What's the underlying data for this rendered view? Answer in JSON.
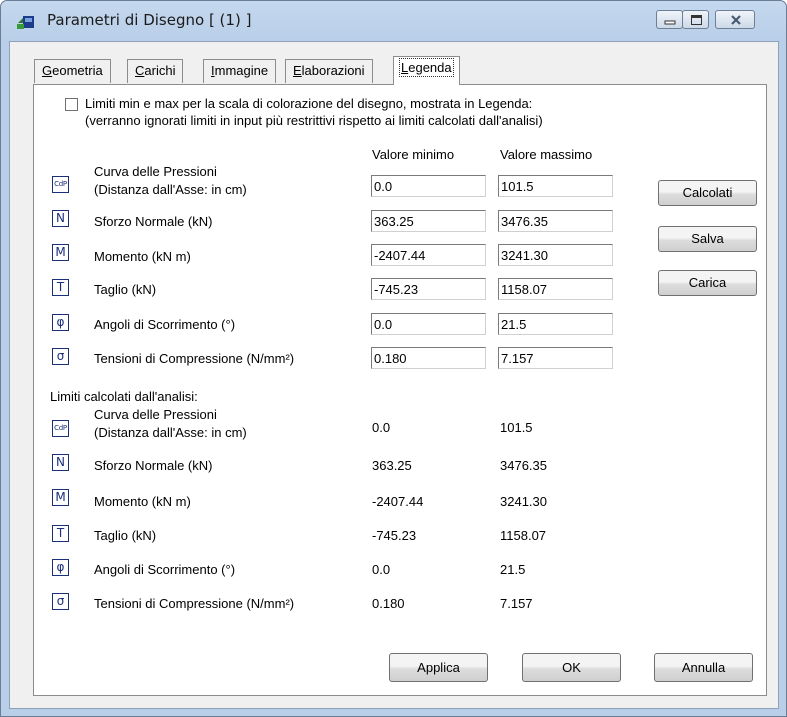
{
  "window": {
    "title": "Parametri di Disegno [ (1) ]"
  },
  "tabs": [
    {
      "pre": "",
      "u": "G",
      "post": "eometria"
    },
    {
      "pre": "",
      "u": "C",
      "post": "arichi"
    },
    {
      "pre": "",
      "u": "I",
      "post": "mmagine"
    },
    {
      "pre": "",
      "u": "E",
      "post": "laborazioni"
    },
    {
      "pre": "",
      "u": "L",
      "post": "egenda"
    }
  ],
  "limits_checkbox": {
    "checked": false,
    "label_line1": "Limiti min e max per la scala di colorazione del disegno, mostrata in Legenda:",
    "label_line2": "(verranno ignorati limiti in input più restrittivi rispetto ai limiti calcolati dall'analisi)"
  },
  "columns": {
    "min": "Valore minimo",
    "max": "Valore massimo"
  },
  "rows": [
    {
      "icon": "CdP",
      "label1": "Curva delle Pressioni",
      "label2": "(Distanza dall'Asse: in cm)",
      "min": "0.0",
      "max": "101.5"
    },
    {
      "icon": "N",
      "label1": "Sforzo Normale (kN)",
      "min": "363.25",
      "max": "3476.35"
    },
    {
      "icon": "M",
      "label1": "Momento (kN m)",
      "min": "-2407.44",
      "max": "3241.30"
    },
    {
      "icon": "T",
      "label1": "Taglio (kN)",
      "min": "-745.23",
      "max": "1158.07"
    },
    {
      "icon": "φ",
      "label1": "Angoli di Scorrimento (°)",
      "min": "0.0",
      "max": "21.5"
    },
    {
      "icon": "σ",
      "label1": "Tensioni di Compressione (N/mm²)",
      "min": "0.180",
      "max": "7.157"
    }
  ],
  "computed_heading": "Limiti calcolati dall'analisi:",
  "computed": [
    {
      "icon": "CdP",
      "label1": "Curva delle Pressioni",
      "label2": "(Distanza dall'Asse: in cm)",
      "min": "0.0",
      "max": "101.5"
    },
    {
      "icon": "N",
      "label1": "Sforzo Normale (kN)",
      "min": "363.25",
      "max": "3476.35"
    },
    {
      "icon": "M",
      "label1": "Momento (kN m)",
      "min": "-2407.44",
      "max": "3241.30"
    },
    {
      "icon": "T",
      "label1": "Taglio (kN)",
      "min": "-745.23",
      "max": "1158.07"
    },
    {
      "icon": "φ",
      "label1": "Angoli di Scorrimento (°)",
      "min": "0.0",
      "max": "21.5"
    },
    {
      "icon": "σ",
      "label1": "Tensioni di Compressione (N/mm²)",
      "min": "0.180",
      "max": "7.157"
    }
  ],
  "side_buttons": {
    "calcolati": "Calcolati",
    "salva": "Salva",
    "carica": "Carica"
  },
  "bottom_buttons": {
    "applica": "Applica",
    "ok": "OK",
    "annulla": "Annulla"
  }
}
